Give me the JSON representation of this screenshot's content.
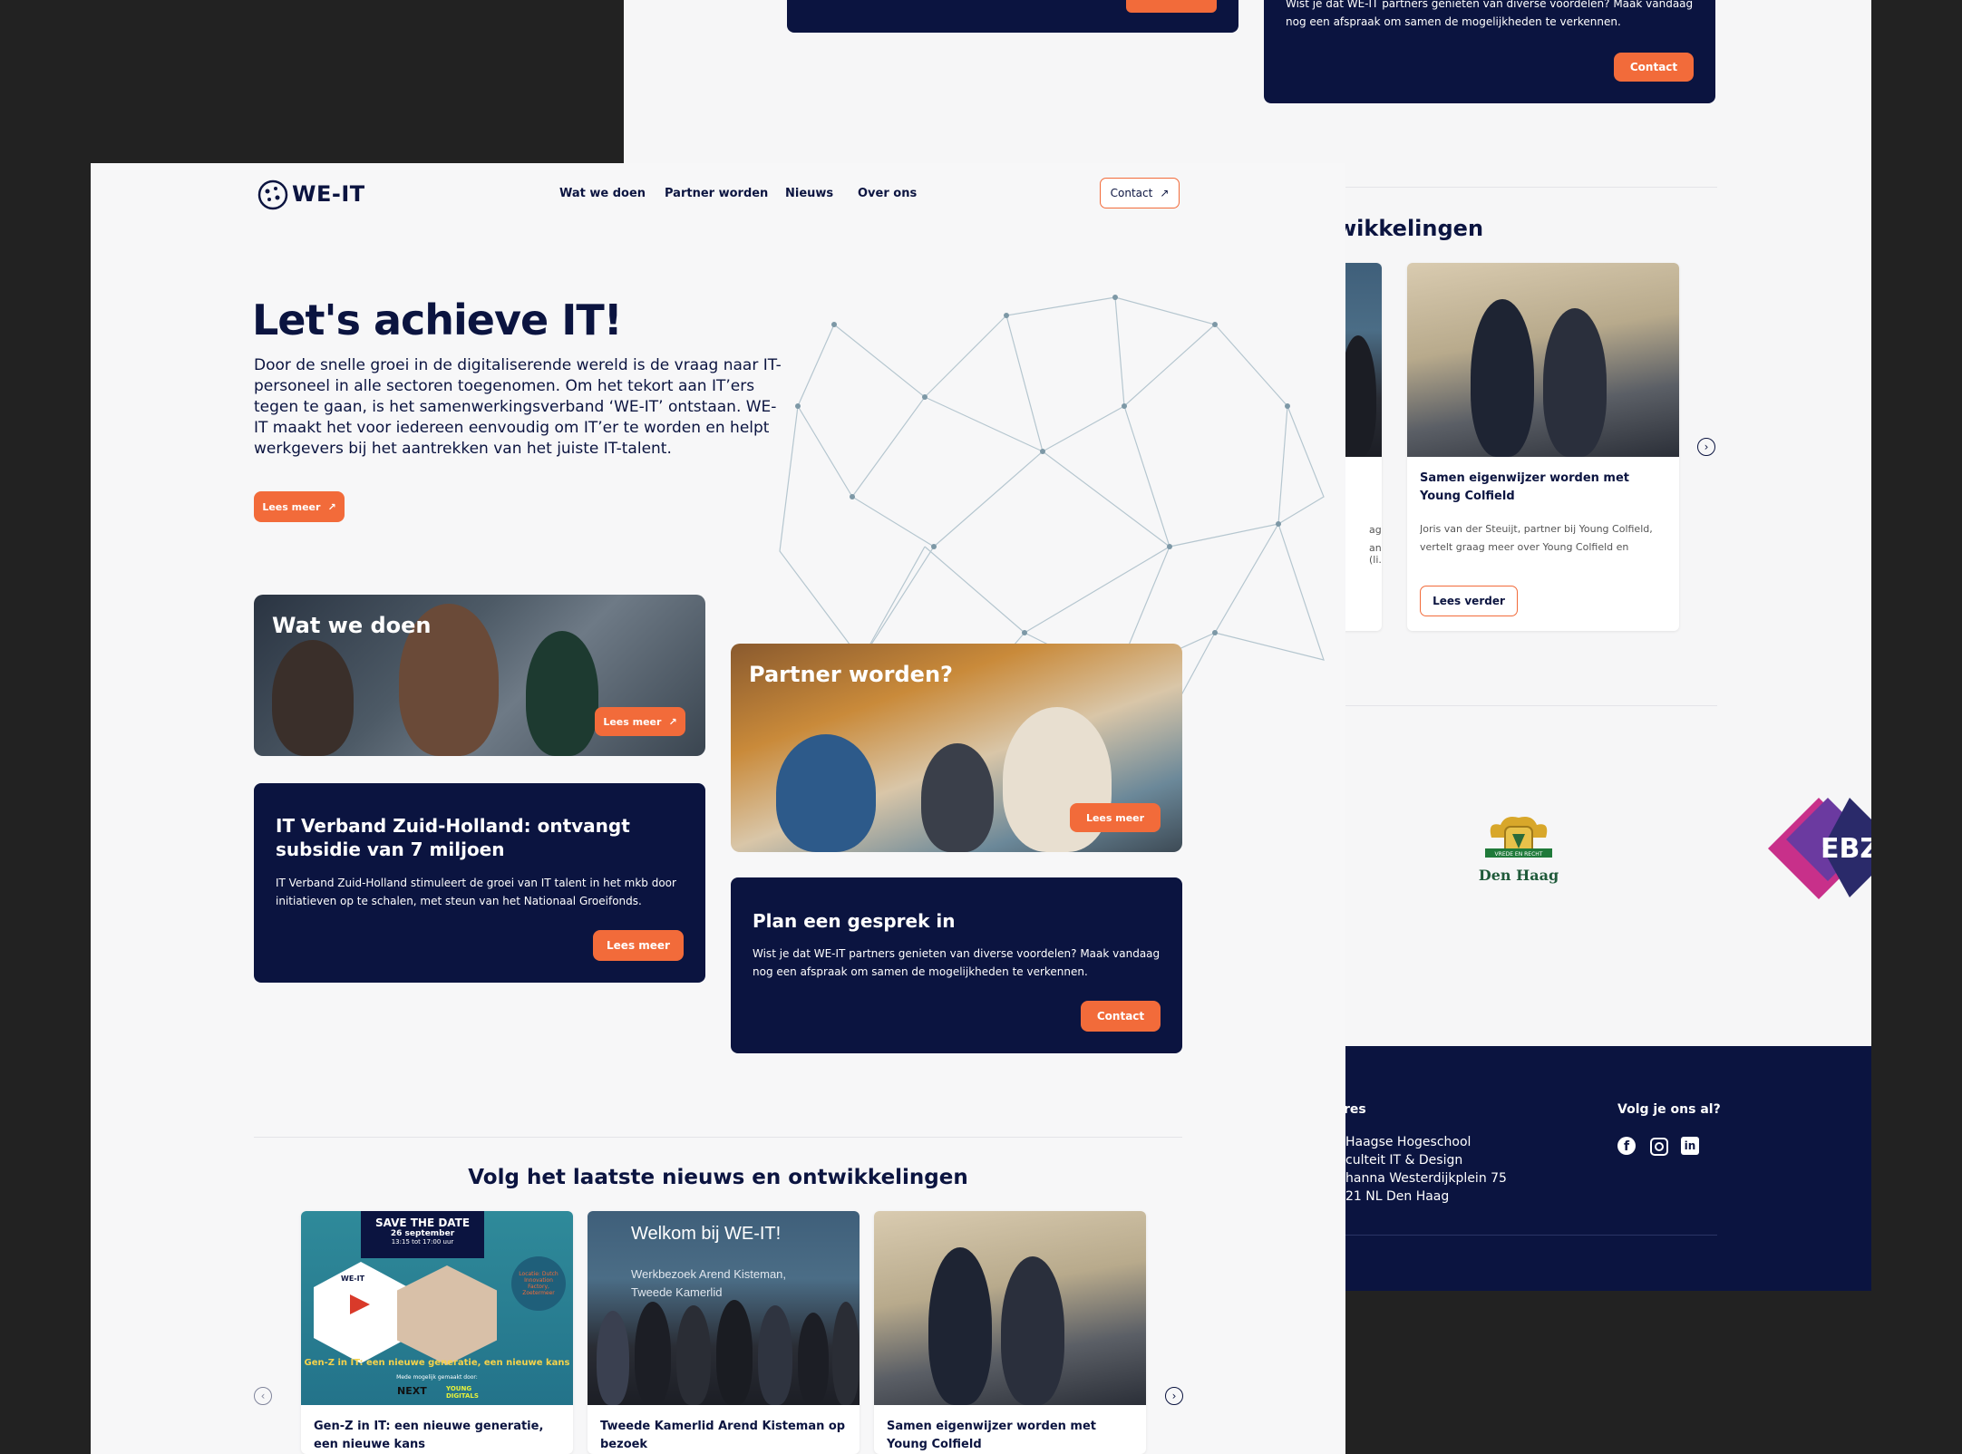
{
  "brand": {
    "name": "WE-IT",
    "accent": "#f26b3a",
    "navy": "#0b1440"
  },
  "nav": {
    "items": [
      "Wat we doen",
      "Partner worden",
      "Nieuws",
      "Over ons"
    ],
    "contact_label": "Contact"
  },
  "hero": {
    "title": "Let's achieve IT!",
    "body": "Door de snelle groei in de digitaliserende wereld is de vraag naar IT-personeel in alle sectoren toegenomen. Om het tekort aan IT’ers tegen te gaan, is het samenwerkingsverband ‘WE-IT’ ontstaan. WE-IT maakt het voor iedereen eenvoudig om IT’er te worden en helpt werkgevers bij het aantrekken van het juiste IT-talent.",
    "button": "Lees meer"
  },
  "cards": {
    "wat_we_doen": {
      "title": "Wat we doen",
      "button": "Lees meer"
    },
    "partner": {
      "title": "Partner worden?",
      "button": "Lees meer"
    },
    "subsidie": {
      "title": "IT Verband Zuid-Holland: ontvangt subsidie van 7 miljoen",
      "body": "IT Verband Zuid-Holland stimuleert de groei van IT talent in het mkb door initiatieven op te schalen, met steun van het Nationaal Groeifonds.",
      "button": "Lees meer"
    },
    "gesprek": {
      "title": "Plan een gesprek in",
      "body": "Wist je dat WE-IT partners genieten van diverse voordelen? Maak vandaag nog een afspraak om samen de mogelijkheden te verkennen.",
      "button": "Contact"
    }
  },
  "news": {
    "heading": "Volg het laatste nieuws en ontwikkelingen",
    "items": [
      {
        "title": "Gen-Z in IT: een nieuwe generatie, een nieuwe kans",
        "poster_top": "SAVE THE DATE",
        "poster_date": "26 september",
        "poster_time": "13:15 tot 17:00 uur",
        "poster_location": "Locatie: Dutch Innovation Factory, Zoetermeer",
        "poster_bottom": "Gen-Z in IT: een nieuwe generatie, een nieuwe kans",
        "poster_small": "Mede mogelijk gemaakt door:",
        "poster_logo_1": "NEXT",
        "poster_logo_2": "YOUNG DIGITALS",
        "poster_we_it": "WE-IT"
      },
      {
        "title": "Tweede Kamerlid Arend Kisteman op bezoek",
        "overlay_title": "Welkom bij WE-IT!",
        "overlay_sub": "Werkbezoek Arend Kisteman, Tweede Kamerlid"
      },
      {
        "title": "Samen eigenwijzer worden met Young Colfield"
      }
    ]
  },
  "back": {
    "gesprek_body": "Wist je dat WE-IT partners genieten van diverse voordelen? Maak vandaag nog een afspraak om samen de mogelijkheden te verkennen.",
    "gesprek_button": "Contact",
    "news_heading_partial": "wikkelingen",
    "news_card": {
      "title": "Samen eigenwijzer worden met Young Colfield",
      "body": "Joris van der Steuijt, partner bij Young Colfield, vertelt graag meer over Young Colfield en waarom...",
      "button": "Lees verder",
      "left_snippet_1": "ag",
      "left_snippet_2": "an (li..."
    },
    "logos": {
      "den_haag": "Den Haag",
      "den_haag_banner": "VREDE EN RECHT",
      "ebz": "EBZ"
    },
    "footer": {
      "address_title": "res",
      "address_lines": [
        "Haagse Hogeschool",
        "culteit IT & Design",
        "hanna Westerdijkplein 75",
        "21 NL Den Haag"
      ],
      "follow_title": "Volg je ons al?",
      "socials": [
        "facebook-icon",
        "instagram-icon",
        "linkedin-icon"
      ]
    }
  }
}
